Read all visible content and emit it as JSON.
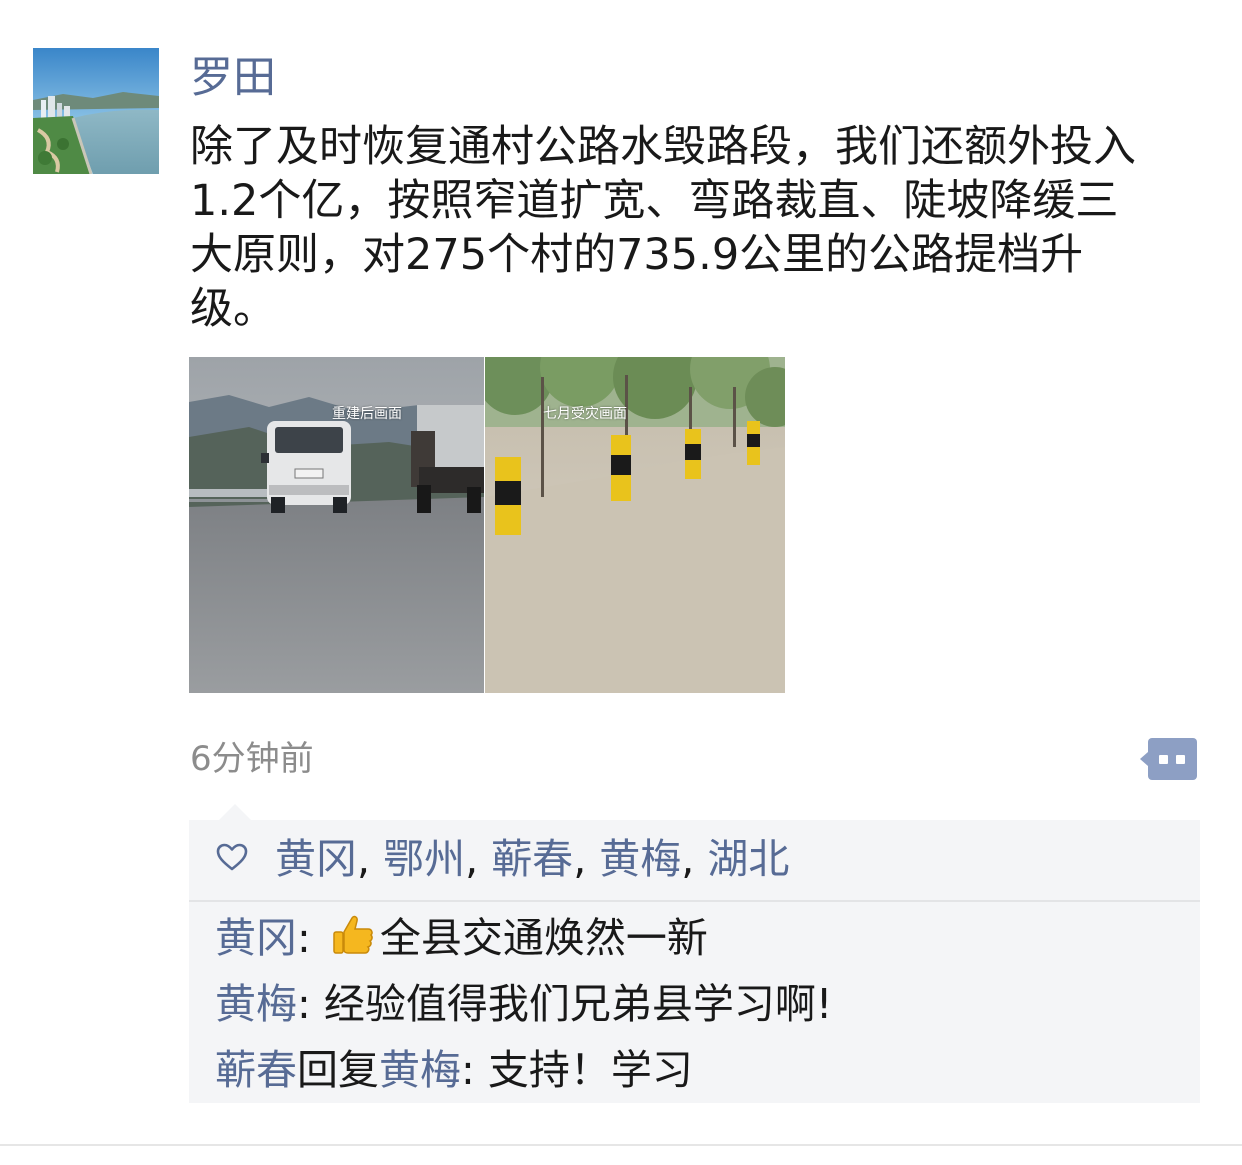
{
  "post": {
    "author": "罗田",
    "text_lines": [
      "除了及时恢复通村公路水毁路段，我们还额外投入",
      "1.2个亿，按照窄道扩宽、弯路裁直、陡坡降缓三",
      "大原则，对275个村的735.9公里的公路提档升",
      "级。"
    ],
    "image_left_caption": "重建后画面",
    "image_right_caption": "七月受灾画面",
    "time": "6分钟前"
  },
  "likes": {
    "icon": "heart-outline-icon",
    "names": [
      "黄冈",
      "鄂州",
      "蕲春",
      "黄梅",
      "湖北"
    ],
    "separator": ","
  },
  "comments": [
    {
      "author": "黄冈",
      "colon": ":",
      "emoji": "thumbs-up-icon",
      "text": "全县交通焕然一新"
    },
    {
      "author": "黄梅",
      "colon": ":",
      "text": "经验值得我们兄弟县学习啊!"
    },
    {
      "author": "蕲春",
      "reply_word": "回复",
      "reply_to": "黄梅",
      "colon": ":",
      "text": "支持！学习"
    }
  ],
  "colors": {
    "name_link": "#576b95",
    "body_text": "#191919",
    "time_text": "#8c8c8c",
    "panel_bg": "#f4f5f7",
    "more_button": "#8d9fc4"
  }
}
